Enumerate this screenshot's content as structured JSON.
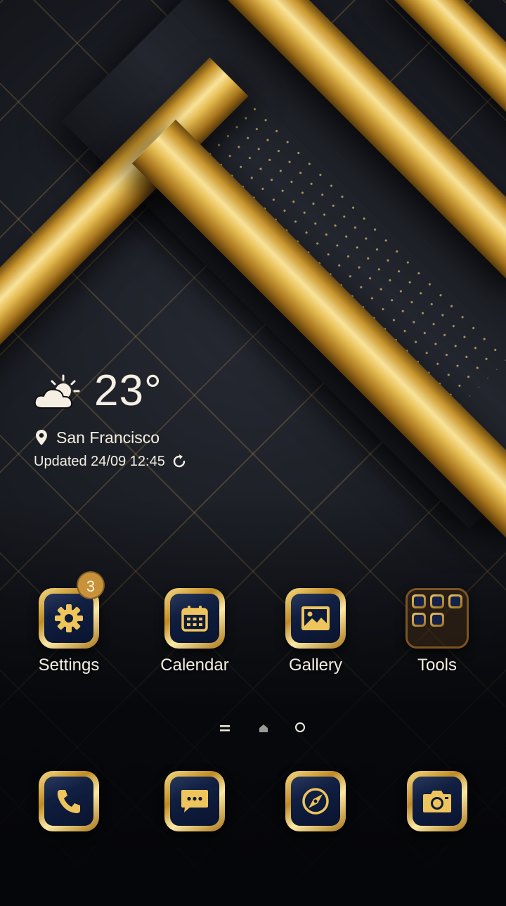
{
  "weather": {
    "temperature": "23°",
    "location": "San Francisco",
    "updated": "Updated 24/09 12:45",
    "condition_icon": "partly-cloudy-icon"
  },
  "apps": [
    {
      "label": "Settings",
      "icon": "gear-icon",
      "badge": "3"
    },
    {
      "label": "Calendar",
      "icon": "calendar-icon"
    },
    {
      "label": "Gallery",
      "icon": "image-icon"
    },
    {
      "label": "Tools",
      "icon": "folder-icon"
    }
  ],
  "dock": [
    {
      "icon": "phone-icon"
    },
    {
      "icon": "message-icon"
    },
    {
      "icon": "compass-icon"
    },
    {
      "icon": "camera-icon"
    }
  ],
  "page_indicator": {
    "pages": 3,
    "current": 2
  },
  "colors": {
    "gold": "#e3b64e",
    "navy": "#0d1a39",
    "text": "#f4efe2",
    "badge": "#c8923a"
  }
}
